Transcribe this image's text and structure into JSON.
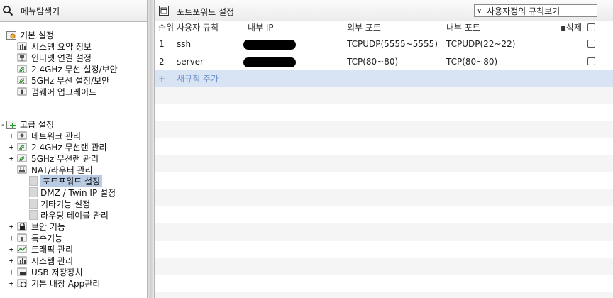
{
  "left_panel": {
    "title": "메뉴탐색기",
    "basic": {
      "label": "기본 설정",
      "items": [
        {
          "label": "시스템 요약 정보",
          "icon": "chart-icon"
        },
        {
          "label": "인터넷 연결 설정",
          "icon": "network-icon"
        },
        {
          "label": "2.4GHz 무선 설정/보안",
          "icon": "wireless-icon"
        },
        {
          "label": "5GHz 무선 설정/보안",
          "icon": "wireless-icon"
        },
        {
          "label": "펌웨어 업그레이드",
          "icon": "upgrade-icon"
        }
      ]
    },
    "advanced": {
      "label": "고급 설정",
      "items": [
        {
          "label": "네트워크 관리",
          "toggle": "+",
          "icon": "network-manage-icon"
        },
        {
          "label": "2.4GHz 무선랜 관리",
          "toggle": "+",
          "icon": "wireless-icon"
        },
        {
          "label": "5GHz 무선랜 관리",
          "toggle": "+",
          "icon": "wireless-icon"
        },
        {
          "label": "NAT/라우터 관리",
          "toggle": "−",
          "icon": "router-icon"
        }
      ],
      "nat_children": [
        {
          "label": "포트포워드 설정",
          "selected": true
        },
        {
          "label": "DMZ / Twin IP 설정"
        },
        {
          "label": "기타기능 설정"
        },
        {
          "label": "라우팅 테이블 관리"
        }
      ],
      "more_items": [
        {
          "label": "보안 기능",
          "toggle": "+",
          "icon": "lock-icon"
        },
        {
          "label": "특수기능",
          "toggle": "+",
          "icon": "special-icon"
        },
        {
          "label": "트래픽 관리",
          "toggle": "+",
          "icon": "traffic-icon"
        },
        {
          "label": "시스템 관리",
          "toggle": "+",
          "icon": "system-icon"
        },
        {
          "label": "USB 저장장치",
          "toggle": "+",
          "icon": "usb-icon"
        },
        {
          "label": "기본 내장 App관리",
          "toggle": "+",
          "icon": "app-icon"
        }
      ]
    }
  },
  "main": {
    "title": "포트포워드 설정",
    "view_select": "사용자정의 규칙보기",
    "columns": {
      "order": "순위",
      "rule": "사용자 규칙",
      "internal_ip": "내부 IP",
      "external_port": "외부 포트",
      "internal_port": "내부 포트",
      "delete": "삭제"
    },
    "rows": [
      {
        "order": "1",
        "rule": "ssh",
        "external_port": "TCPUDP(5555~5555)",
        "internal_port": "TCPUDP(22~22)"
      },
      {
        "order": "2",
        "rule": "server",
        "external_port": "TCP(80~80)",
        "internal_port": "TCP(80~80)"
      }
    ],
    "add_rule": {
      "plus": "+",
      "label": "새규칙 추가"
    }
  },
  "colors": {
    "selected_bg": "#b8cbe2",
    "add_row_bg": "#d8e3f3",
    "add_text": "#6d90c8",
    "alt_row_bg": "#f5f5f5"
  }
}
